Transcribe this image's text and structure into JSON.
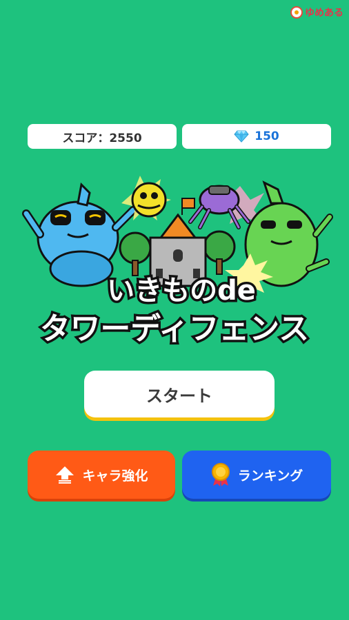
{
  "brand": {
    "name": "ゆめある"
  },
  "stats": {
    "score_label": "スコア：2550",
    "gems_value": "150",
    "gem_icon": "diamond-icon"
  },
  "hero": {
    "title_line1": "いきものde",
    "title_line2": "タワーディフェンス"
  },
  "buttons": {
    "start": "スタート",
    "upgrade": "キャラ強化",
    "ranking": "ランキング"
  },
  "colors": {
    "background": "#1ec27e",
    "start_shadow": "#f4c20d",
    "upgrade": "#ff5a16",
    "ranking": "#1f63f0",
    "gem": "#1a73d9"
  }
}
